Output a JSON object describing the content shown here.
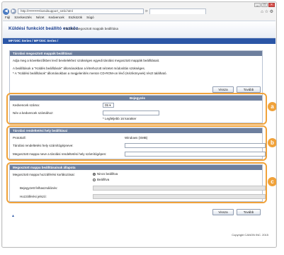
{
  "browser": {
    "url": "http://••••••••••/sendsupport_smb.html",
    "tab_title": "",
    "menu": [
      "Fájl",
      "Szerkesztés",
      "Nézet",
      "Kedvencek",
      "Eszközök",
      "Súgó"
    ]
  },
  "app": {
    "title": "Küldési funkciót beállító eszköz",
    "subtitle": "Tárolási megosztott mappák beállítása",
    "model": "MF720C Series / MF720C Series /"
  },
  "intro": {
    "header": "Tárolási megosztott mappák beállításai",
    "line1": "Adja meg a következőkben levő bevitelekhez szükséges egyedi tárolási megosztott mappák beállításait.",
    "line2": "A beállítások a \"Küldés beállítások\" állomásokban a létrehozott nézetet módosítás szükséges.",
    "line3": "* A \"Küldési beállítások\" állomásokban a megjelenítés menün CD-ROM-on lévő (Kézikönyvek) részt található."
  },
  "buttons": {
    "back": "Vissza",
    "next": "Tovább"
  },
  "registration": {
    "header": "Bejegyzés",
    "favorites_number_label": "Kedvencek száma:",
    "favorites_number_value": "05",
    "favorites_name_label": "Név a kedvencek számához:",
    "favorites_name_value": "",
    "note": "* Legfeljebb 16 karakter"
  },
  "destination": {
    "header": "Tárolási rendeltetési hely beállításai",
    "protocol_label": "Protokoll:",
    "protocol_value": "Windows (SMB)",
    "hostname_label": "Tárolási rendeltetési hely számítógépneve:",
    "sharedfolder_label": "Megosztott mappa neve a tárolási rendeltetési hely számítógépen:"
  },
  "status": {
    "header": "Megosztott mappa beállításainak állapota",
    "restriction_label": "Megosztott mappa hozzáférési korlátozásai:",
    "option_off": "Nincs beállítva",
    "option_on": "Beállítva",
    "username_label": "Bejegyzett felhasználónév:",
    "password_label": "Hozzáférési jelszó:"
  },
  "badges": {
    "a": "a",
    "b": "b",
    "c": "c"
  },
  "footer": {
    "copyright": "Copyright CANON INC. 2015",
    "top_link": "▲"
  },
  "colors": {
    "accent": "#2b56a6",
    "highlight": "#f0a23a",
    "section_header": "#6d7f9e"
  }
}
